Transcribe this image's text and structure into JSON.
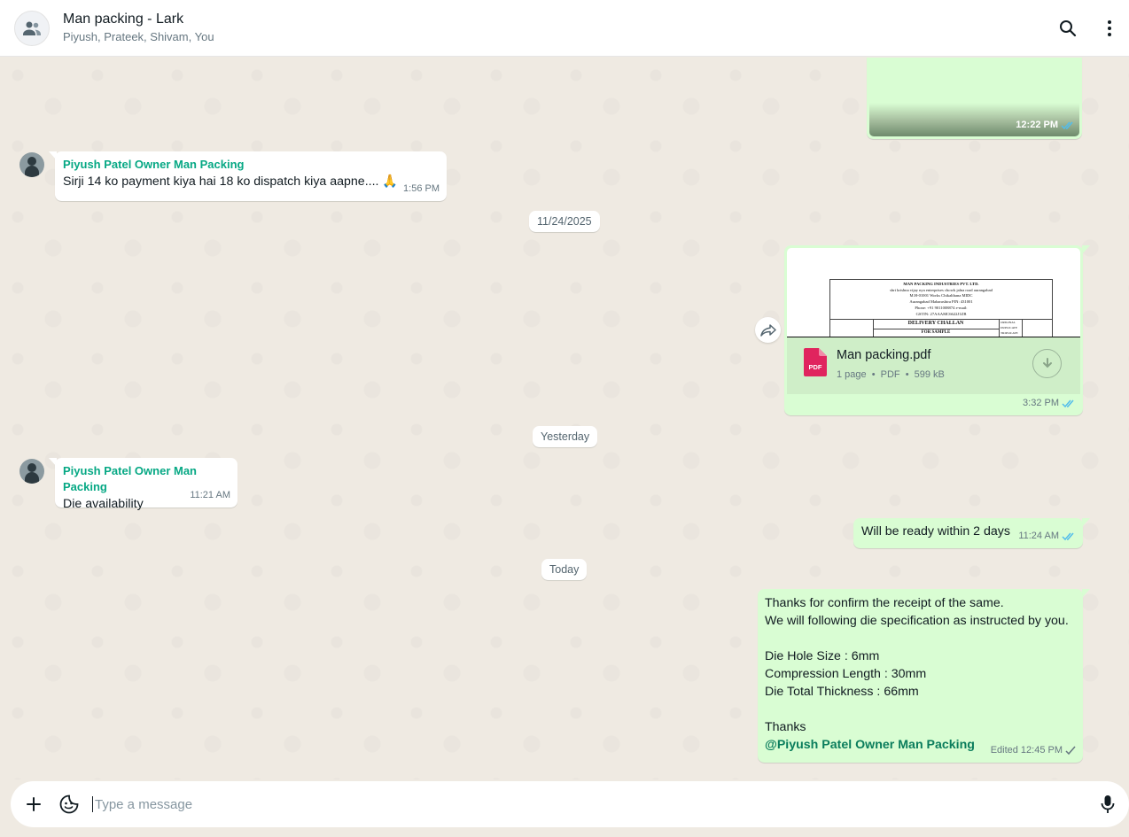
{
  "header": {
    "title": "Man packing - Lark",
    "members": "Piyush, Prateek, Shivam, You"
  },
  "messages": {
    "m0": {
      "time": "12:22 PM"
    },
    "m1": {
      "sender": "Piyush Patel Owner Man Packing",
      "text": "Sirji 14 ko payment kiya hai 18 ko dispatch kiya aapne....",
      "emoji": "🙏",
      "time": "1:56 PM"
    },
    "d1": {
      "label": "11/24/2025"
    },
    "m2": {
      "filename": "Man packing.pdf",
      "pages": "1 page",
      "type": "PDF",
      "size": "599 kB",
      "time": "3:32 PM",
      "preview": {
        "company": "MAN PACKING INDUSTRIES PVT. LTD.",
        "address1": "shri krishna vijay nya enterprises chowk jalna road aurangabad",
        "address2": "M.H-01001 Works Chikalthana MIDC",
        "address3": "Aurangabad  Maharashtra  PIN: 431001",
        "phone": "Phone: +91 9011008874  e-mail:",
        "gstin": "GSTIN: 27AAAMC6622J1ZB",
        "title": "DELIVERY CHALLAN",
        "subtitle": "FOR SAMPLE",
        "right1": "ORIGINAL",
        "right2": "DUPLICATE",
        "right3": "TRIPLICATE"
      }
    },
    "d2": {
      "label": "Yesterday"
    },
    "m3": {
      "sender": "Piyush Patel Owner Man Packing",
      "text": "Die availability",
      "time": "11:21 AM"
    },
    "m4": {
      "text": "Will be ready within 2 days",
      "time": "11:24 AM"
    },
    "d3": {
      "label": "Today"
    },
    "m5": {
      "line1": "Thanks for confirm the receipt of the same.",
      "line2": "We will following die specification as instructed by you.",
      "line3": "Die Hole Size : 6mm",
      "line4": "Compression Length : 30mm",
      "line5": "Die Total Thickness : 66mm",
      "line6": "Thanks",
      "mention": "@Piyush Patel Owner Man Packing",
      "edited": "Edited",
      "time": "12:45 PM"
    }
  },
  "composer": {
    "placeholder": "Type a message"
  },
  "colors": {
    "outgoing": "#d9fdd3",
    "incoming": "#ffffff",
    "sender_name": "#06a884",
    "read_tick": "#53bdeb",
    "pdf_red": "#e0245e"
  }
}
